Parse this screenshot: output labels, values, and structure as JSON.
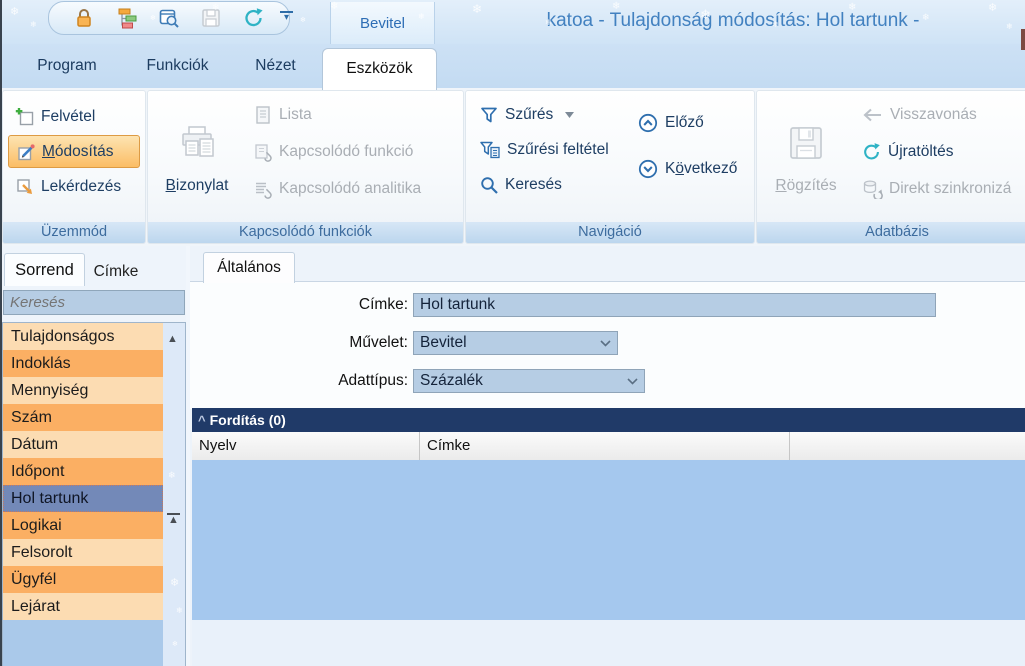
{
  "window": {
    "title": "katoa - Tulajdonság módosítás: Hol tartunk -",
    "document_tab": "Bevitel"
  },
  "qat": {
    "icon_names": [
      "lock-icon",
      "hierarchy-icon",
      "preview-window-icon",
      "save-icon",
      "refresh-icon",
      "more-commands-icon"
    ]
  },
  "icons": {
    "qat_more": "▾",
    "dropdown_caret": "▾",
    "section_collapse": "^",
    "scrollbar_up": "▲",
    "scroll_top_marker": "▲",
    "snowflake": "❄"
  },
  "ribbon": {
    "tabs": [
      {
        "label": "Program",
        "active": false
      },
      {
        "label": "Funkciók",
        "active": false
      },
      {
        "label": "Nézet",
        "active": false
      },
      {
        "label": "Eszközök",
        "active": true
      }
    ],
    "groups": [
      {
        "title": "Üzemmód",
        "items": [
          {
            "label": "Felvétel",
            "enabled": true,
            "selected": false
          },
          {
            "pre": "",
            "accel": "M",
            "post": "ódosítás",
            "enabled": true,
            "selected": true
          },
          {
            "label": "Lekérdezés",
            "enabled": true,
            "selected": false
          }
        ]
      },
      {
        "title": "Kapcsolódó funkciók",
        "big": {
          "pre": "",
          "accel": "B",
          "post": "izonylat",
          "enabled": true
        },
        "items": [
          {
            "label": "Lista",
            "enabled": false
          },
          {
            "label": "Kapcsolódó funkció",
            "enabled": false
          },
          {
            "label": "Kapcsolódó analitika",
            "enabled": false
          }
        ]
      },
      {
        "title": "Navigáció",
        "items": [
          {
            "label": "Szűrés",
            "enabled": true,
            "has_dropdown": true
          },
          {
            "label": "Szűrési feltétel",
            "enabled": true
          },
          {
            "label": "Keresés",
            "enabled": true
          }
        ],
        "items2": [
          {
            "label": "Előző",
            "enabled": true
          },
          {
            "pre": "K",
            "accel": "ö",
            "post": "vetkező",
            "enabled": true
          }
        ]
      },
      {
        "title": "Adatbázis",
        "big": {
          "pre": "",
          "accel": "R",
          "post": "ögzítés",
          "enabled": false
        },
        "items": [
          {
            "label": "Visszavonás",
            "enabled": false
          },
          {
            "label": "Újratöltés",
            "enabled": true
          },
          {
            "label": "Direkt szinkronizá",
            "enabled": false
          }
        ]
      }
    ]
  },
  "sidebar": {
    "tabs": [
      {
        "label": "Sorrend",
        "active": true
      },
      {
        "label": "Címke",
        "active": false
      }
    ],
    "search_placeholder": "Keresés",
    "list": [
      {
        "label": "Tulajdonságos",
        "selected": false
      },
      {
        "label": "Indoklás",
        "selected": false
      },
      {
        "label": "Mennyiség",
        "selected": false
      },
      {
        "label": "Szám",
        "selected": false
      },
      {
        "label": "Dátum",
        "selected": false
      },
      {
        "label": "Időpont",
        "selected": false
      },
      {
        "label": "Hol tartunk",
        "selected": true
      },
      {
        "label": "Logikai",
        "selected": false
      },
      {
        "label": "Felsorolt",
        "selected": false
      },
      {
        "label": "Ügyfél",
        "selected": false
      },
      {
        "label": "Lejárat",
        "selected": false
      }
    ]
  },
  "main": {
    "tab": "Általános",
    "fields": [
      {
        "label": "Címke:",
        "value": "Hol tartunk",
        "type": "text"
      },
      {
        "label": "Művelet:",
        "value": "Bevitel",
        "type": "select"
      },
      {
        "label": "Adattípus:",
        "value": "Százalék",
        "type": "select"
      }
    ],
    "section": {
      "title": "Fordítás (0)"
    },
    "table": {
      "headers": [
        "Nyelv",
        "Címke",
        ""
      ]
    }
  },
  "colors": {
    "accent_blue": "#2f6fae",
    "title_text": "#4281c0",
    "section_navy": "#203a68",
    "input_bg": "#b6cde4",
    "row_light": "#fcdcb2",
    "row_dark": "#fbaf63",
    "row_selected": "#7389b8",
    "table_body": "#a5c8ee",
    "orange_highlight": "#fbbd65",
    "teal_refresh": "#2fb3c5"
  }
}
